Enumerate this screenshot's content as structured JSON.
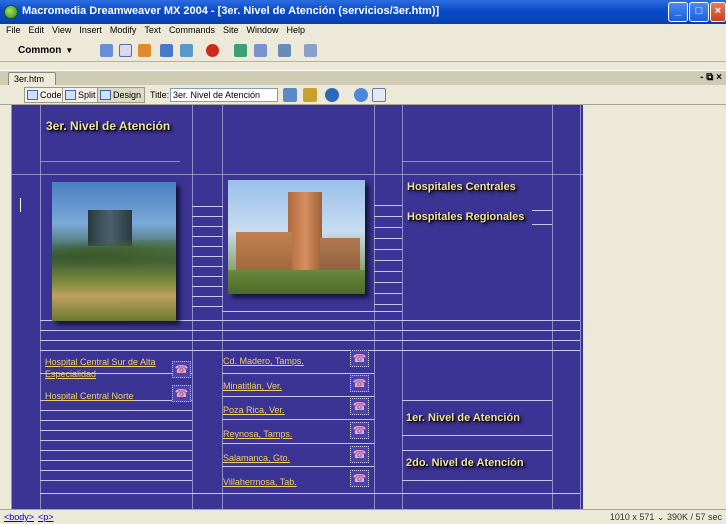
{
  "window": {
    "title": "Macromedia Dreamweaver MX 2004 - [3er. Nivel de Atención (servicios/3er.htm)]",
    "controls": [
      "_",
      "□",
      "×"
    ]
  },
  "menubar": [
    "File",
    "Edit",
    "View",
    "Insert",
    "Modify",
    "Text",
    "Commands",
    "Site",
    "Window",
    "Help"
  ],
  "insertbar": {
    "category": "Common"
  },
  "document": {
    "tab": "3er.htm",
    "controls": "- ⧉ ×",
    "view_buttons": [
      "Code",
      "Split",
      "Design"
    ],
    "title_label": "Title:",
    "title_value": "3er. Nivel de Atención"
  },
  "page": {
    "header": "3er. Nivel de Atención",
    "nav_right": [
      "Hospitales Centrales",
      "Hospitales Regionales"
    ],
    "nav_bottom": [
      "1er. Nivel de Atención",
      "2do. Nivel de Atención"
    ],
    "left_links": [
      "Hospital Central Sur de Alta",
      "Especialidad",
      "Hospital Central Norte"
    ],
    "middle_links": [
      "Cd. Madero, Tamps.",
      "Minatitlán, Ver.",
      "Poza Rica, Ver.",
      "Reynosa, Tamps.",
      "Salamanca, Gto.",
      "Villahermosa, Tab."
    ]
  },
  "statusbar": {
    "tags": [
      "<body>",
      "<p>"
    ],
    "info": "1010 x 571 ⌄ 390K / 57 sec"
  },
  "colors": {
    "canvas": "#3b3494",
    "heading": "#f4e3a0",
    "link": "#f0d060"
  }
}
